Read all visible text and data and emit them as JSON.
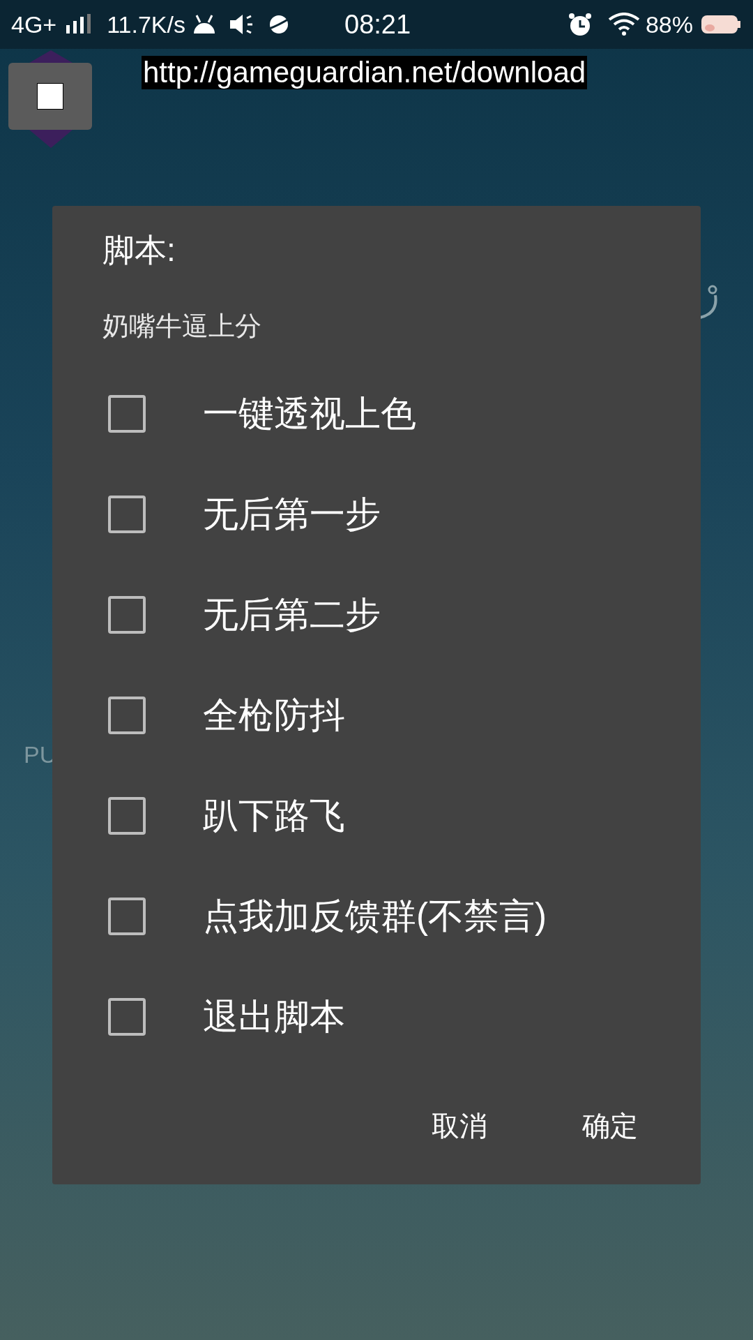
{
  "status_bar": {
    "network": "4G+",
    "speed": "11.7K/s",
    "time": "08:21",
    "battery": "88%"
  },
  "overlay": {
    "url": "http://gameguardian.net/download"
  },
  "background": {
    "label": "PU"
  },
  "dialog": {
    "title": "脚本:",
    "subtitle": "奶嘴牛逼上分",
    "options": [
      {
        "label": "一键透视上色",
        "checked": false
      },
      {
        "label": "无后第一步",
        "checked": false
      },
      {
        "label": "无后第二步",
        "checked": false
      },
      {
        "label": "全枪防抖",
        "checked": false
      },
      {
        "label": "趴下路飞",
        "checked": false
      },
      {
        "label": "点我加反馈群(不禁言)",
        "checked": false
      },
      {
        "label": "退出脚本",
        "checked": false
      }
    ],
    "buttons": [
      "取消",
      "确定"
    ]
  }
}
